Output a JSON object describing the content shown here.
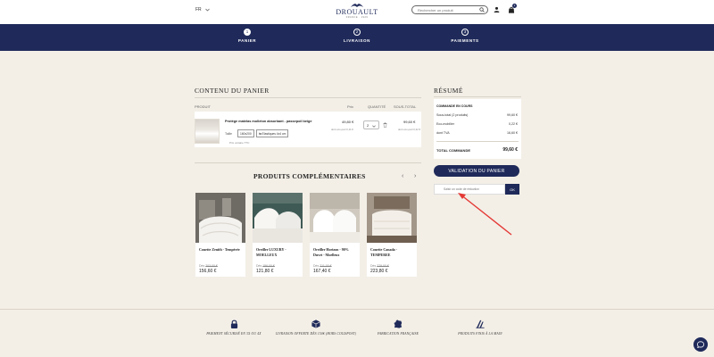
{
  "header": {
    "lang": "FR",
    "logo_text": "DROUAULT",
    "logo_sub": "FRANCE · 1929",
    "search_placeholder": "Rechercher un produit",
    "cart_count": "1"
  },
  "steps": [
    {
      "num": "1",
      "label": "PANIER"
    },
    {
      "num": "2",
      "label": "LIVRAISON"
    },
    {
      "num": "3",
      "label": "PAIEMENTS"
    }
  ],
  "cart": {
    "title": "CONTENU DU PANIER",
    "headers": {
      "produit": "PRODUIT",
      "prix": "Prix",
      "quantite": "QUANTITÉ",
      "sous_total": "SOUS-TOTAL"
    },
    "item": {
      "name": "Protège matelas molleton absorbant - passepoil beige",
      "taille_label": "Taille",
      "chip1": "160x200",
      "chip2": "⇆ Elastiques 4x4 cm",
      "tax_note": "Prix unitaire TTC",
      "prix": "49,80 €",
      "prix_eco": "dont éco-part 0,11 €",
      "qty": "2",
      "sous_total": "99,60 €",
      "st_eco": "dont éco-part 0,22 €"
    }
  },
  "complementary": {
    "title": "PRODUITS COMPLÉMENTAIRES",
    "prev": "‹",
    "next": "›",
    "products": [
      {
        "name": "Couette Zenith - Tempérée",
        "old_label": "Dès",
        "old": "203,00 €",
        "new": "156,60 €"
      },
      {
        "name": "Oreiller LUXURY - MOELLEUX",
        "old_label": "Dès",
        "old": "156,00 €",
        "new": "121,80 €"
      },
      {
        "name": "Oreiller Horizon - 90% Duvet - Moelleux",
        "old_label": "Dès",
        "old": "211,00 €",
        "new": "167,40 €"
      },
      {
        "name": "Couette Canada - TEMPEREE",
        "old_label": "Dès",
        "old": "279,00 €",
        "new": "223,80 €"
      }
    ]
  },
  "summary": {
    "title": "RÉSUMÉ",
    "subtitle": "COMMANDE EN COURS",
    "lines": [
      {
        "label": "Sous-total (2 produits)",
        "value": "99,60 €"
      },
      {
        "label": "Eco-mobilier",
        "value": "0,22 €"
      },
      {
        "label": "dont TVA",
        "value": "16,60 €"
      }
    ],
    "total_label": "TOTAL COMMANDE",
    "total_value": "99,60 €",
    "validate_label": "VALIDATION DU PANIER",
    "code_placeholder": "Saisir un code de réduction",
    "ok_label": "OK"
  },
  "footer": {
    "features": [
      {
        "icon": "lock-icon",
        "label": "PAIEMENT SÉCURISÉ EN 3X OU 4X"
      },
      {
        "icon": "box-icon",
        "label": "LIVRAISON OFFERTE DÈS 150€ (HORS COLISPOST)"
      },
      {
        "icon": "france-map-icon",
        "label": "FABRICATION FRANÇAISE"
      },
      {
        "icon": "handmade-icon",
        "label": "PRODUITS FINIS À LA MAIN"
      }
    ]
  },
  "colors": {
    "navy": "#1f2a5a",
    "cream": "#f3efe7",
    "annotation": "#e53935"
  }
}
